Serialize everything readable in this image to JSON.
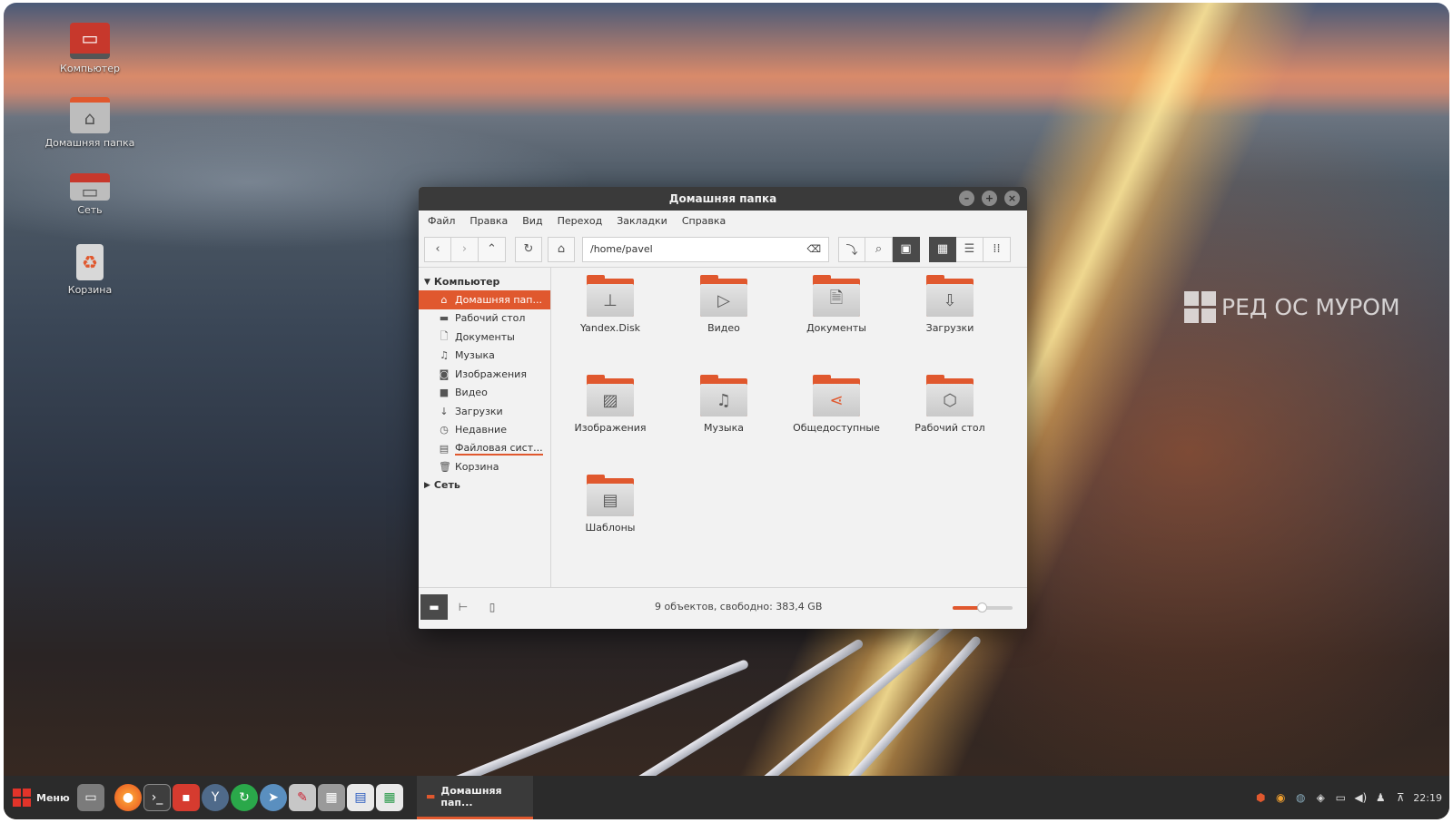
{
  "desktop": {
    "icons": [
      {
        "label": "Компьютер",
        "icon": "monitor-icon"
      },
      {
        "label": "Домашняя папка",
        "icon": "home-folder-icon"
      },
      {
        "label": "Сеть",
        "icon": "network-icon"
      },
      {
        "label": "Корзина",
        "icon": "trash-icon"
      }
    ],
    "brand_text": "РЕД ОС МУРОМ"
  },
  "window": {
    "title": "Домашняя папка",
    "menu": [
      "Файл",
      "Правка",
      "Вид",
      "Переход",
      "Закладки",
      "Справка"
    ],
    "address": "/home/pavel",
    "sidebar": {
      "computer_label": "Компьютер",
      "items": [
        {
          "label": "Домашняя пап...",
          "icon": "home-icon",
          "active": true
        },
        {
          "label": "Рабочий стол",
          "icon": "desktop-folder-icon"
        },
        {
          "label": "Документы",
          "icon": "document-icon"
        },
        {
          "label": "Музыка",
          "icon": "music-icon"
        },
        {
          "label": "Изображения",
          "icon": "camera-icon"
        },
        {
          "label": "Видео",
          "icon": "video-icon"
        },
        {
          "label": "Загрузки",
          "icon": "download-icon"
        },
        {
          "label": "Недавние",
          "icon": "clock-icon"
        },
        {
          "label": "Файловая сист...",
          "icon": "drive-icon"
        },
        {
          "label": "Корзина",
          "icon": "trash-icon"
        }
      ],
      "network_label": "Сеть"
    },
    "files": [
      {
        "label": "Yandex.Disk",
        "icon": "network-drive-icon"
      },
      {
        "label": "Видео",
        "icon": "video-folder-icon"
      },
      {
        "label": "Документы",
        "icon": "documents-folder-icon"
      },
      {
        "label": "Загрузки",
        "icon": "downloads-folder-icon"
      },
      {
        "label": "Изображения",
        "icon": "pictures-folder-icon"
      },
      {
        "label": "Музыка",
        "icon": "music-folder-icon"
      },
      {
        "label": "Общедоступные",
        "icon": "share-folder-icon"
      },
      {
        "label": "Рабочий стол",
        "icon": "desktop-folder-icon"
      },
      {
        "label": "Шаблоны",
        "icon": "templates-folder-icon"
      }
    ],
    "status_text": "9 объектов, свободно: 383,4 GB",
    "zoom_level": 0.48
  },
  "taskbar": {
    "menu_label": "Меню",
    "task_label": "Домашняя пап...",
    "clock": "22:19"
  },
  "colors": {
    "accent": "#e0582e",
    "titlebar": "#3a3a3a",
    "taskbar": "#2b2b2b"
  }
}
